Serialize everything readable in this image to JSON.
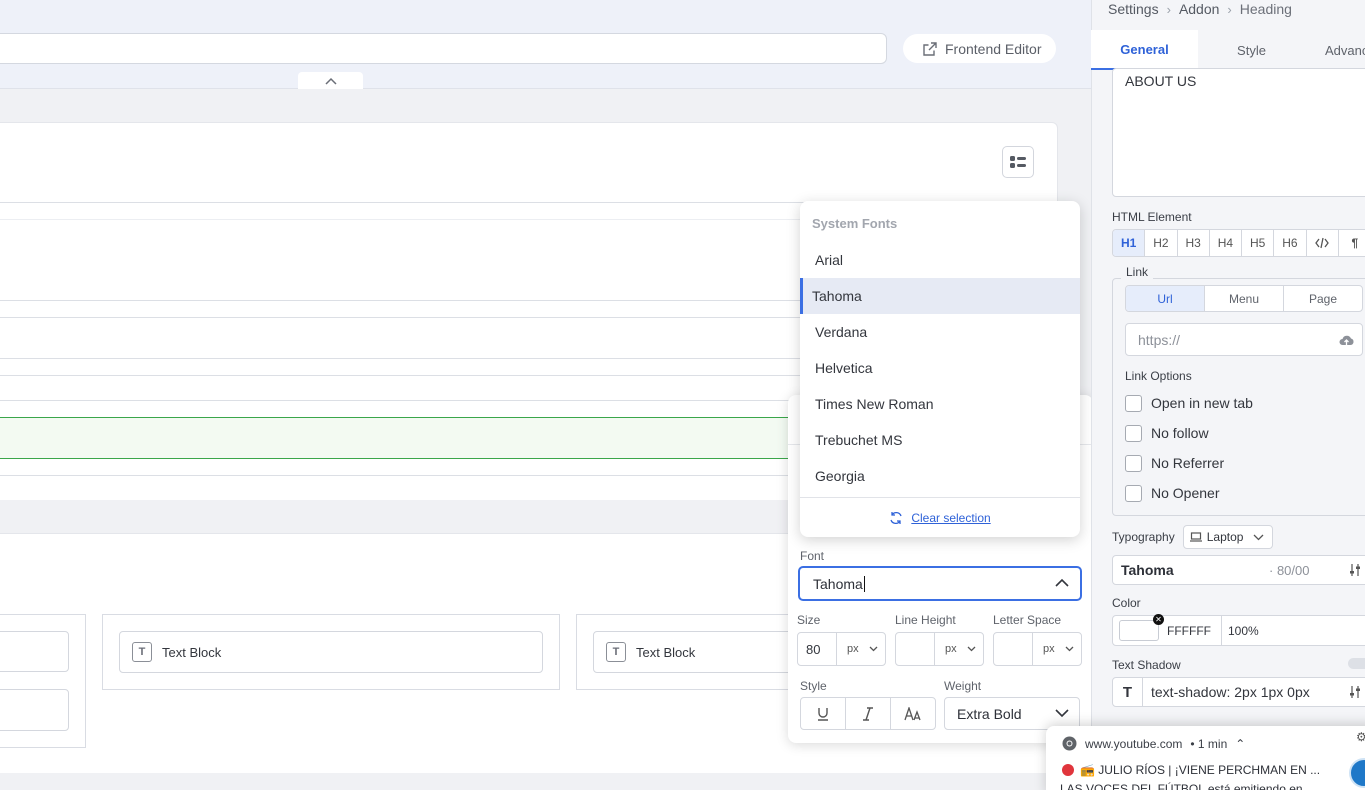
{
  "toolbar": {
    "frontend_editor": "Frontend Editor"
  },
  "canvas": {
    "text_block_1": "Text Block",
    "text_block_2": "Text Block"
  },
  "font_dropdown": {
    "group_label": "System Fonts",
    "items": [
      "Arial",
      "Tahoma",
      "Verdana",
      "Helvetica",
      "Times New Roman",
      "Trebuchet MS",
      "Georgia"
    ],
    "selected": "Tahoma",
    "clear_label": "Clear selection"
  },
  "typography_popover": {
    "font_label": "Font",
    "font_value": "Tahoma",
    "size_label": "Size",
    "size_value": "80",
    "size_unit": "px",
    "line_height_label": "Line Height",
    "line_height_unit": "px",
    "letter_space_label": "Letter Space",
    "letter_space_unit": "px",
    "style_label": "Style",
    "weight_label": "Weight",
    "weight_value": "Extra Bold"
  },
  "panel": {
    "breadcrumb": [
      "Settings",
      "Addon",
      "Heading"
    ],
    "tabs": [
      "General",
      "Style",
      "Advanced"
    ],
    "title_text": "ABOUT US",
    "html_element_label": "HTML Element",
    "heading_options": [
      "H1",
      "H2",
      "H3",
      "H4",
      "H5",
      "H6"
    ],
    "link_legend": "Link",
    "link_types": [
      "Url",
      "Menu",
      "Page"
    ],
    "url_placeholder": "https://",
    "link_options_label": "Link Options",
    "link_options": [
      "Open in new tab",
      "No follow",
      "No Referrer",
      "No Opener"
    ],
    "typography_label": "Typography",
    "device_value": "Laptop",
    "typography_font": "Tahoma",
    "typography_meta": "· 80/00",
    "color_label": "Color",
    "color_hex": "FFFFFF",
    "color_opacity": "100%",
    "text_shadow_label": "Text Shadow",
    "text_shadow_value": "text-shadow: 2px 1px 0px"
  },
  "notification": {
    "site": "www.youtube.com",
    "age": "• 1 min",
    "title": "📻 JULIO RÍOS | ¡VIENE PERCHMAN EN ...",
    "body": "LAS VOCES DEL FÚTBOL está emitiendo en..."
  },
  "colors": {
    "accent": "#3b6fe3",
    "link": "#2f62d8",
    "green": "#3aa64a"
  }
}
